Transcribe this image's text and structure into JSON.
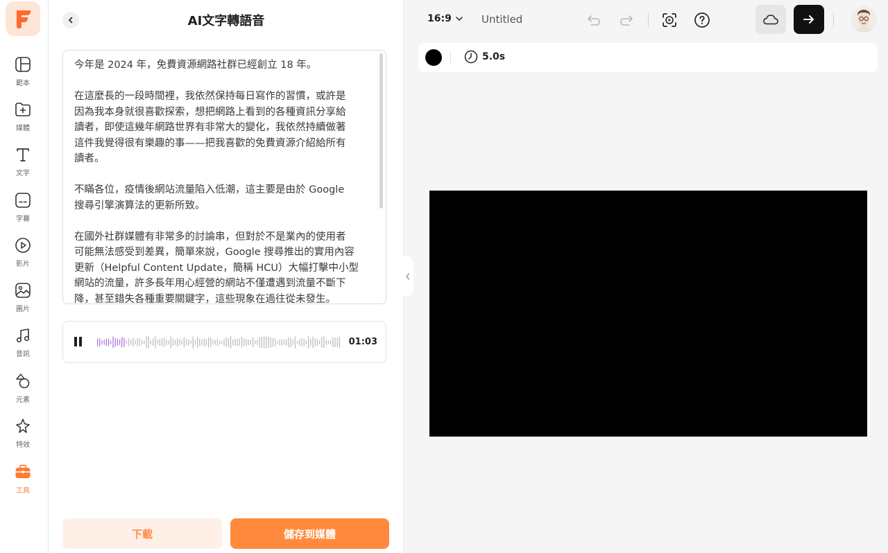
{
  "sidebar": {
    "logo_letter": "F",
    "accent_color": "#ff7a2f",
    "items": [
      {
        "label": "範本",
        "icon": "layout-icon"
      },
      {
        "label": "媒體",
        "icon": "folder-plus-icon"
      },
      {
        "label": "文字",
        "icon": "text-icon"
      },
      {
        "label": "字幕",
        "icon": "subtitle-icon"
      },
      {
        "label": "影片",
        "icon": "video-play-icon"
      },
      {
        "label": "圖片",
        "icon": "image-icon"
      },
      {
        "label": "音訊",
        "icon": "music-note-icon"
      },
      {
        "label": "元素",
        "icon": "shapes-icon"
      },
      {
        "label": "特效",
        "icon": "sparkle-icon"
      },
      {
        "label": "工具",
        "icon": "toolbox-icon",
        "active": true
      }
    ]
  },
  "panel": {
    "title": "AI文字轉語音",
    "paragraphs": [
      "今年是 2024 年，免費資源網路社群已經創立 18 年。",
      "在這麼長的一段時間裡，我依然保持每日寫作的習慣，或許是\n因為我本身就很喜歡探索，想把網路上看到的各種資訊分享給\n讀者，即使這幾年網路世界有非常大的變化，我依然持續做著\n這件我覺得很有樂趣的事——把我喜歡的免費資源介紹給所有\n讀者。",
      "不瞞各位，疫情後網站流量陷入低潮，這主要是由於 Google\n搜尋引擎演算法的更新所致。",
      "在國外社群媒體有非常多的討論串，但對於不是業內的使用者\n可能無法感受到差異，簡單來說，Google 搜尋推出的實用內容\n更新（Helpful Content Update，簡稱 HCU）大幅打擊中小型\n網站的流量，許多長年用心經營的網站不僅遭遇到流量不斷下\n降，甚至錯失各種重要關鍵字，這些現象在過往從未發生。"
    ],
    "player": {
      "state_icon": "pause-icon",
      "time": "01:03",
      "played_fraction": 0.11
    },
    "download_label": "下載",
    "save_label": "儲存到媒體"
  },
  "topbar": {
    "aspect_ratio": "16:9",
    "doc_title": "Untitled"
  },
  "scene": {
    "background_color": "#000000",
    "duration": "5.0s"
  }
}
